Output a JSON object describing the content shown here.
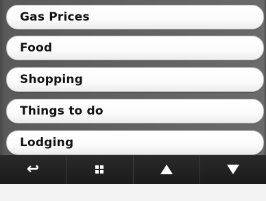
{
  "menu": {
    "items": [
      {
        "label": "Gas Prices"
      },
      {
        "label": "Food"
      },
      {
        "label": "Shopping"
      },
      {
        "label": "Things to do"
      },
      {
        "label": "Lodging"
      }
    ]
  },
  "toolbar": {
    "buttons": [
      {
        "icon": "back-arrow-icon"
      },
      {
        "icon": "grid-menu-icon"
      },
      {
        "icon": "scroll-up-icon"
      },
      {
        "icon": "scroll-down-icon"
      }
    ]
  },
  "colors": {
    "toolbar_background": "#1b1b1b",
    "list_background": "#5a5a5a",
    "item_background": "#ffffff",
    "label_color": "#111111"
  }
}
